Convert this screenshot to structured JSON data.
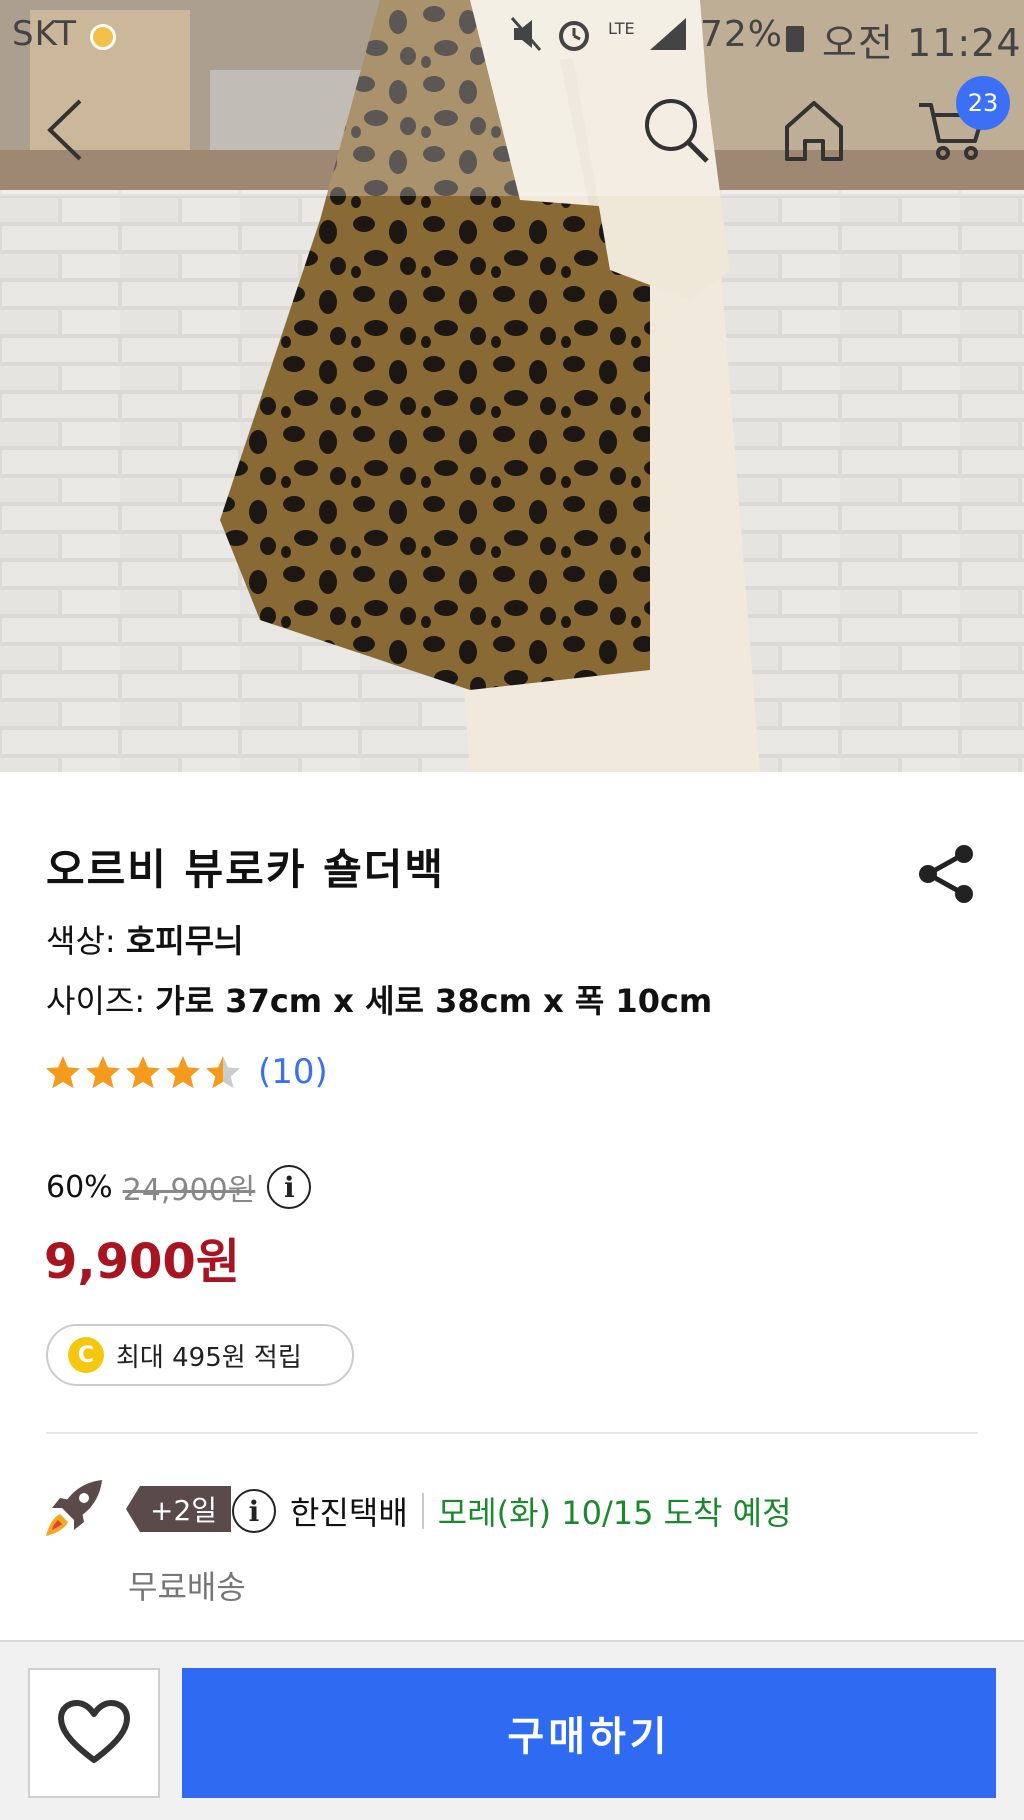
{
  "status_bar": {
    "carrier": "SKT",
    "battery": "72%",
    "time": "오전 11:24",
    "network": "LTE"
  },
  "nav": {
    "cart_count": "23"
  },
  "product": {
    "title": "오르비 뷰로카 숄더백",
    "color_label": "색상: ",
    "color_value": "호피무늬",
    "size_label": "사이즈: ",
    "size_value": "가로 37cm x 세로 38cm x 폭 10cm",
    "rating": 4.5,
    "review_count": "(10)"
  },
  "pricing": {
    "discount": "60%",
    "original_price": "24,900원",
    "price": "9,900원",
    "info_icon": "i",
    "points_icon": "C",
    "points_label": "최대 495원 적립"
  },
  "delivery": {
    "days": "+2일",
    "carrier": "한진택배",
    "eta": "모레(화) 10/15 도착 예정",
    "free_shipping": "무료배송"
  },
  "actions": {
    "buy_label": "구매하기"
  },
  "colors": {
    "accent": "#2f6bf2",
    "price": "#a8141f",
    "eta": "#1b8a2e",
    "star": "#f59a1b"
  }
}
